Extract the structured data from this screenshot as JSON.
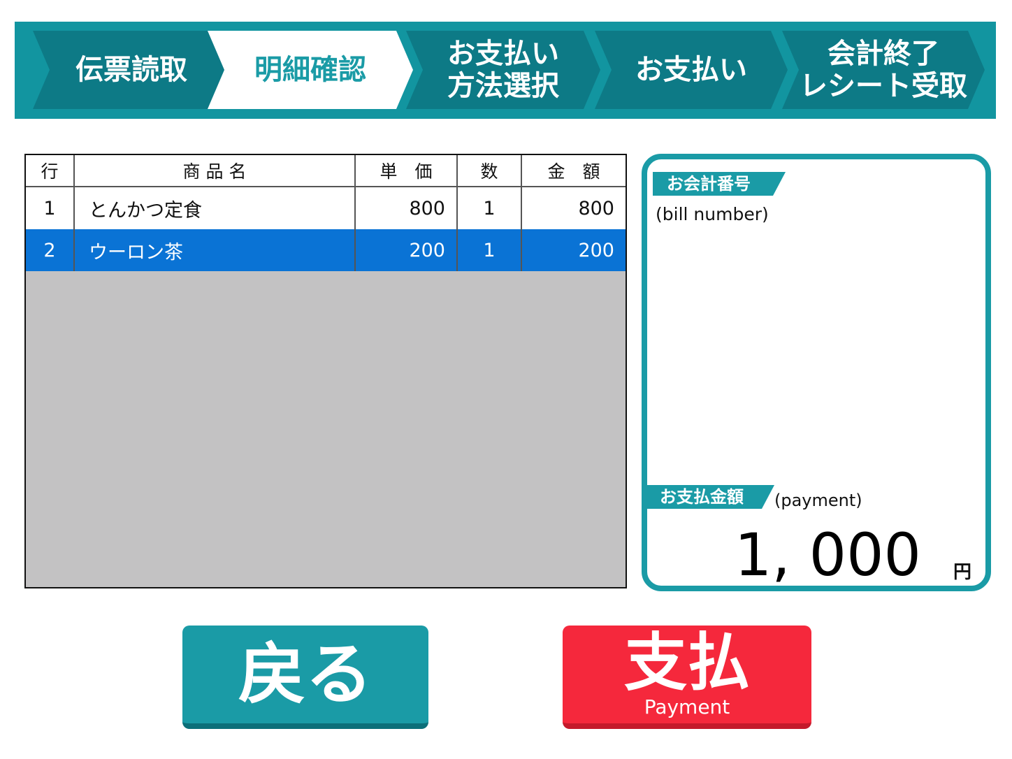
{
  "steps": [
    {
      "label": "伝票読取",
      "active": false
    },
    {
      "label": "明細確認",
      "active": true
    },
    {
      "label": "お支払い\n方法選択",
      "active": false
    },
    {
      "label": "お支払い",
      "active": false
    },
    {
      "label": "会計終了\nレシート受取",
      "active": false
    }
  ],
  "table": {
    "headers": [
      "行",
      "商 品 名",
      "単　価",
      "数",
      "金　額"
    ],
    "rows": [
      {
        "line": "1",
        "name": "とんかつ定食",
        "price": "800",
        "qty": "1",
        "amount": "800",
        "selected": false
      },
      {
        "line": "2",
        "name": "ウーロン茶",
        "price": "200",
        "qty": "1",
        "amount": "200",
        "selected": true
      }
    ]
  },
  "panel": {
    "bill_label": "お会計番号",
    "bill_sub": "(bill number)",
    "bill_number": "",
    "pay_label": "お支払金額",
    "pay_sub": "(payment)",
    "amount": "1, 000",
    "currency": "円"
  },
  "buttons": {
    "back_label": "戻る",
    "pay_label": "支払",
    "pay_sub": "Payment"
  },
  "colors": {
    "teal": "#1a9ba6",
    "dark_teal": "#0d7a86",
    "selected_row": "#0a73d5",
    "pay_red": "#f5283c",
    "table_bg": "#c3c2c3"
  }
}
